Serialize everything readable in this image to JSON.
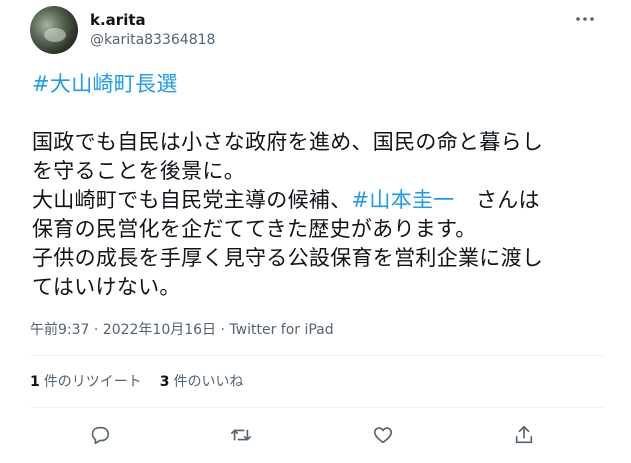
{
  "user": {
    "display_name": "k.arita",
    "handle": "@karita83364818"
  },
  "tweet": {
    "hashtag_line": "#大山崎町長選",
    "lines": [
      {
        "parts": [
          "国政でも自民は小さな政府を進め、国民の命と暮らし"
        ]
      },
      {
        "parts": [
          "を守ることを後景に。"
        ]
      },
      {
        "parts": [
          "大山崎町でも自民党主導の候補、",
          "#山本圭一",
          "　さんは"
        ]
      },
      {
        "parts": [
          "保育の民営化を企だててきた歴史があります。"
        ]
      },
      {
        "parts": [
          "子供の成長を手厚く見守る公設保育を営利企業に渡し"
        ]
      },
      {
        "parts": [
          "てはいけない。"
        ]
      }
    ],
    "meta": "午前9:37 · 2022年10月16日 · Twitter for iPad"
  },
  "stats": {
    "retweets_count": "1",
    "retweets_label": "件のリツイート",
    "likes_count": "3",
    "likes_label": "件のいいね"
  },
  "icons": {
    "more": "more-icon",
    "reply": "reply-icon",
    "retweet": "retweet-icon",
    "like": "like-icon",
    "share": "share-icon"
  },
  "colors": {
    "link": "#1d9bf0",
    "text": "#0f1419",
    "secondary": "#536471",
    "divider": "#eff3f4"
  }
}
